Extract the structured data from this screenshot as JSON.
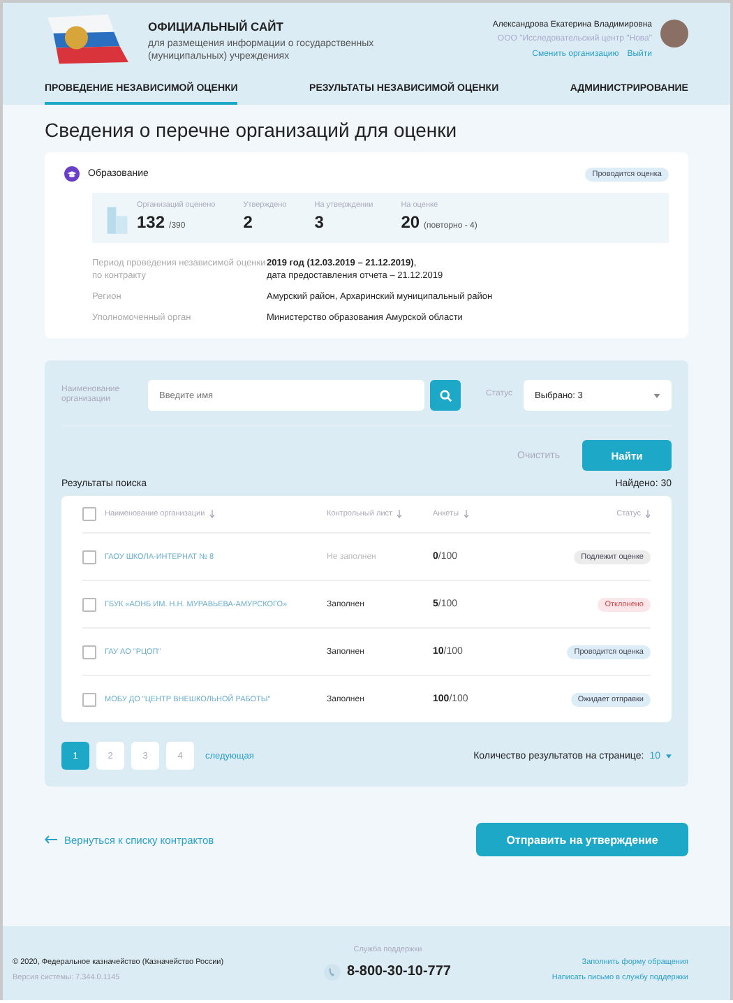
{
  "header": {
    "title": "ОФИЦИАЛЬНЫЙ САЙТ",
    "subtitle": "для размещения информации о государственных (муниципальных) учреждениях",
    "user": {
      "name": "Александрова Екатерина Владимировна",
      "org": "ООО \"Исследовательский центр \"Нова\"",
      "links": [
        "Сменить организацию",
        "Выйти"
      ]
    }
  },
  "tabs": [
    {
      "label": "ПРОВЕДЕНИЕ НЕЗАВИСИМОЙ ОЦЕНКИ",
      "selected": true
    },
    {
      "label": "РЕЗУЛЬТАТЫ НЕЗАВИСИМОЙ ОЦЕНКИ",
      "selected": false
    },
    {
      "label": "АДМИНИСТРИРОВАНИЕ",
      "selected": false
    }
  ],
  "page_title": "Сведения о перечне организаций для оценки",
  "card": {
    "category": "Образование",
    "badge": "Проводится оценка",
    "stats": [
      {
        "label": "Организаций оценено",
        "value": "132",
        "suffix": "/390"
      },
      {
        "label": "Утверждено",
        "value": "2"
      },
      {
        "label": "На утверждении",
        "value": "3"
      },
      {
        "label": "На оценке",
        "value": "20",
        "suffix": "(повторно - 4)"
      }
    ],
    "details": [
      {
        "label": "Период проведения независимой оценки по контракту",
        "value": "**2019 год (12.03.2019 – 21.12.2019)**,",
        "value2": "дата предоставления отчета – 21.12.2019"
      },
      {
        "label": "Регион",
        "value": "Амурский район, Архаринский муниципальный район"
      },
      {
        "label": "Уполномоченный орган",
        "value": "Министерство образования Амурской области"
      }
    ]
  },
  "search": {
    "name_label": "Наименование организации",
    "placeholder": "Введите имя",
    "status_label": "Статус",
    "status_value": "Выбрано: 3",
    "clear": "Очистить",
    "find": "Найти"
  },
  "results": {
    "title": "Результаты поиска",
    "found": "Найдено: 30",
    "select_all_checked": false,
    "columns": [
      "Наименование организации",
      "Контрольный лист",
      "Анкеты",
      "Статус"
    ],
    "rows": [
      {
        "checked": false,
        "name": "ГАОУ ШКОЛА-ИНТЕРНАТ № 8",
        "checklist": "Не заполнен",
        "filled": false,
        "done": "0",
        "total": "/100",
        "status": "Подлежит оценке",
        "kind": "pending"
      },
      {
        "checked": false,
        "name": "ГБУК «АОНБ ИМ. Н.Н. МУРАВЬЕВА-АМУРСКОГО»",
        "checklist": "Заполнен",
        "filled": true,
        "done": "5",
        "total": "/100",
        "status": "Отклонено",
        "kind": "rejected"
      },
      {
        "checked": false,
        "name": "ГАУ АО \"РЦОП\"",
        "checklist": "Заполнен",
        "filled": true,
        "done": "10",
        "total": "/100",
        "status": "Проводится оценка",
        "kind": "progress"
      },
      {
        "checked": false,
        "name": "МОБУ ДО \"ЦЕНТР ВНЕШКОЛЬНОЙ РАБОТЫ\"",
        "checklist": "Заполнен",
        "filled": true,
        "done": "100",
        "total": "/100",
        "status": "Ожидает отправки",
        "kind": "waiting"
      }
    ],
    "pages": [
      {
        "label": "1",
        "selected": true
      },
      {
        "label": "2",
        "selected": false
      },
      {
        "label": "3",
        "selected": false
      },
      {
        "label": "4",
        "selected": false
      }
    ],
    "next": "следующая",
    "per_page_label": "Количество результатов на странице:",
    "per_page": "10"
  },
  "back_link": "Вернуться к списку контрактов",
  "submit": "Отправить на утверждение",
  "footer": {
    "copyright": "© 2020, Федеральное казначейство (Казначейство России)",
    "version": "Версия системы: 7.344.0.1145",
    "support_label": "Служба поддержки",
    "phone": "8-800-30-10-777",
    "links": [
      "Заполнить форму обращения",
      "Написать письмо в службу поддержки"
    ]
  }
}
